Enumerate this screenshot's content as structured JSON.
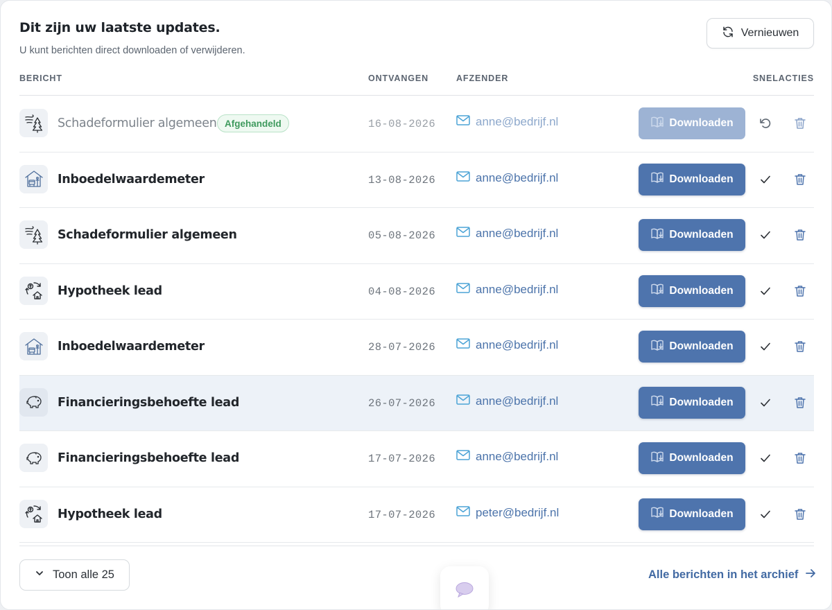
{
  "header": {
    "title": "Dit zijn uw laatste updates.",
    "subtitle": "U kunt berichten direct downloaden of verwijderen.",
    "refresh_label": "Vernieuwen"
  },
  "columns": {
    "message": "BERICHT",
    "received": "ONTVANGEN",
    "sender": "AFZENDER",
    "quick_actions": "SNELACTIES"
  },
  "rows": [
    {
      "name": "Schadeformulier algemeen",
      "badge": "Afgehandeld",
      "date": "16-08-2026",
      "sender": "anne@bedrijf.nl",
      "download_label": "Downloaden",
      "icon": "storm-tree-icon",
      "state": "handled"
    },
    {
      "name": "Inboedelwaardemeter",
      "date": "13-08-2026",
      "sender": "anne@bedrijf.nl",
      "download_label": "Downloaden",
      "icon": "house-contents-icon"
    },
    {
      "name": "Schadeformulier algemeen",
      "date": "05-08-2026",
      "sender": "anne@bedrijf.nl",
      "download_label": "Downloaden",
      "icon": "storm-tree-icon"
    },
    {
      "name": "Hypotheek lead",
      "date": "04-08-2026",
      "sender": "anne@bedrijf.nl",
      "download_label": "Downloaden",
      "icon": "mortgage-house-icon"
    },
    {
      "name": "Inboedelwaardemeter",
      "date": "28-07-2026",
      "sender": "anne@bedrijf.nl",
      "download_label": "Downloaden",
      "icon": "house-contents-icon"
    },
    {
      "name": "Financieringsbehoefte lead",
      "date": "26-07-2026",
      "sender": "anne@bedrijf.nl",
      "download_label": "Downloaden",
      "icon": "piggy-bank-icon",
      "state": "hover"
    },
    {
      "name": "Financieringsbehoefte lead",
      "date": "17-07-2026",
      "sender": "anne@bedrijf.nl",
      "download_label": "Downloaden",
      "icon": "piggy-bank-icon"
    },
    {
      "name": "Hypotheek lead",
      "date": "17-07-2026",
      "sender": "peter@bedrijf.nl",
      "download_label": "Downloaden",
      "icon": "mortgage-house-icon"
    }
  ],
  "footer": {
    "show_all_label": "Toon alle 25",
    "archive_label": "Alle berichten in het archief"
  },
  "colors": {
    "accent": "#4e74ad",
    "accent_faded": "#9db3d4",
    "link": "#426aa3",
    "badge_green": "#3f9a5e",
    "row_highlight": "#edf2f8"
  }
}
